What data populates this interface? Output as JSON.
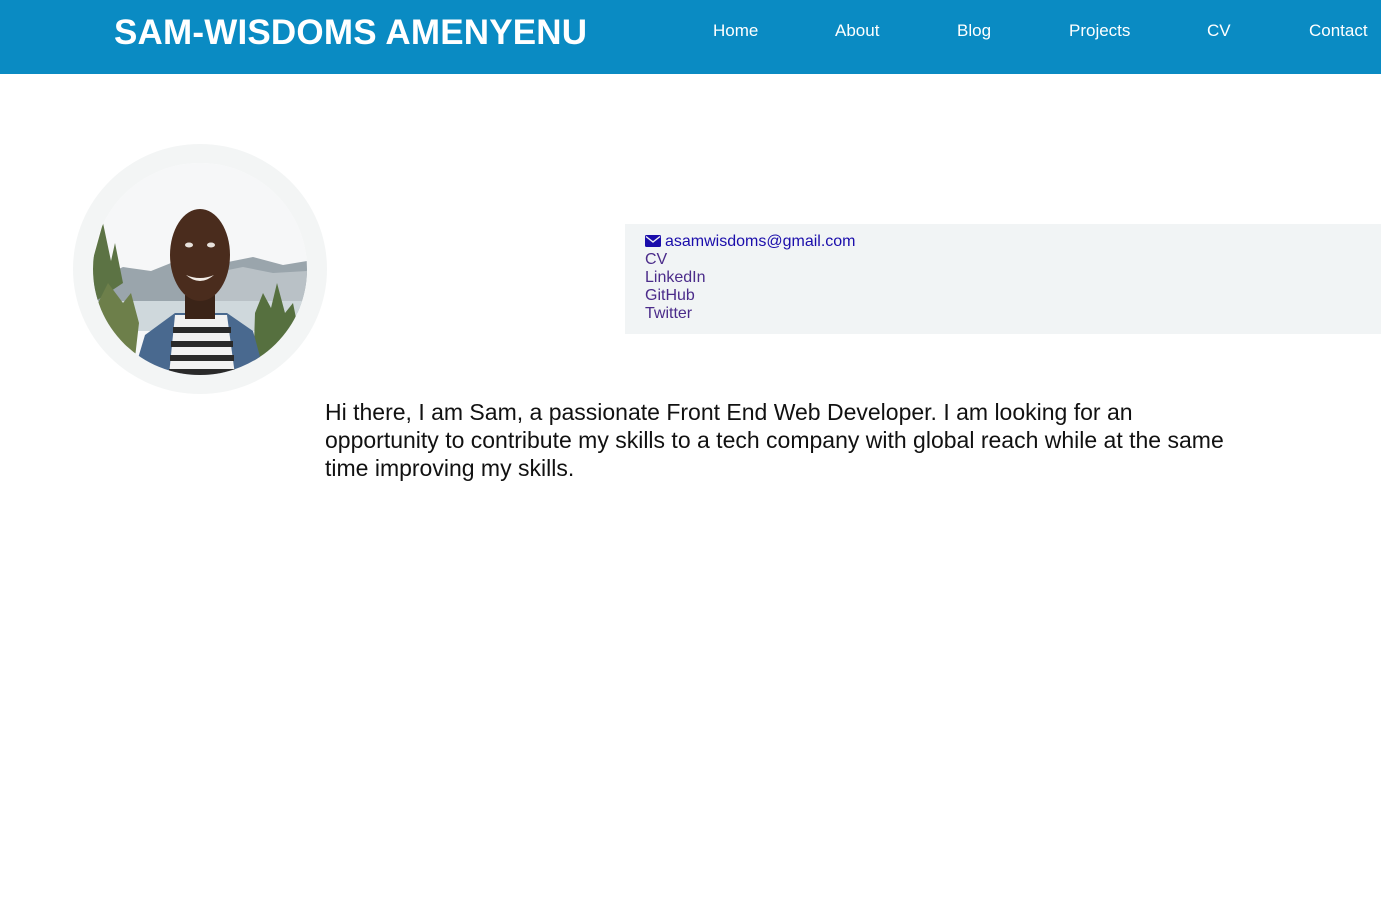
{
  "header": {
    "title": "SAM-WISDOMS AMENYENU",
    "nav": [
      "Home",
      "About",
      "Blog",
      "Projects",
      "CV",
      "Contact"
    ]
  },
  "profile": {
    "avatar_icon": "profile-photo"
  },
  "contact": {
    "email": "asamwisdoms@gmail.com",
    "email_icon": "envelope-icon",
    "links": [
      "CV",
      "LinkedIn",
      "GitHub",
      "Twitter"
    ]
  },
  "bio": {
    "text": "Hi there, I am Sam, a passionate Front End Web Developer. I am looking for an opportunity to contribute my skills to a tech company with global reach while at the same time improving my skills."
  },
  "colors": {
    "header_bg": "#0a8bc3",
    "link": "#1a0dab",
    "visited_link": "#4b2b8a",
    "contact_bg": "#f1f4f5"
  }
}
